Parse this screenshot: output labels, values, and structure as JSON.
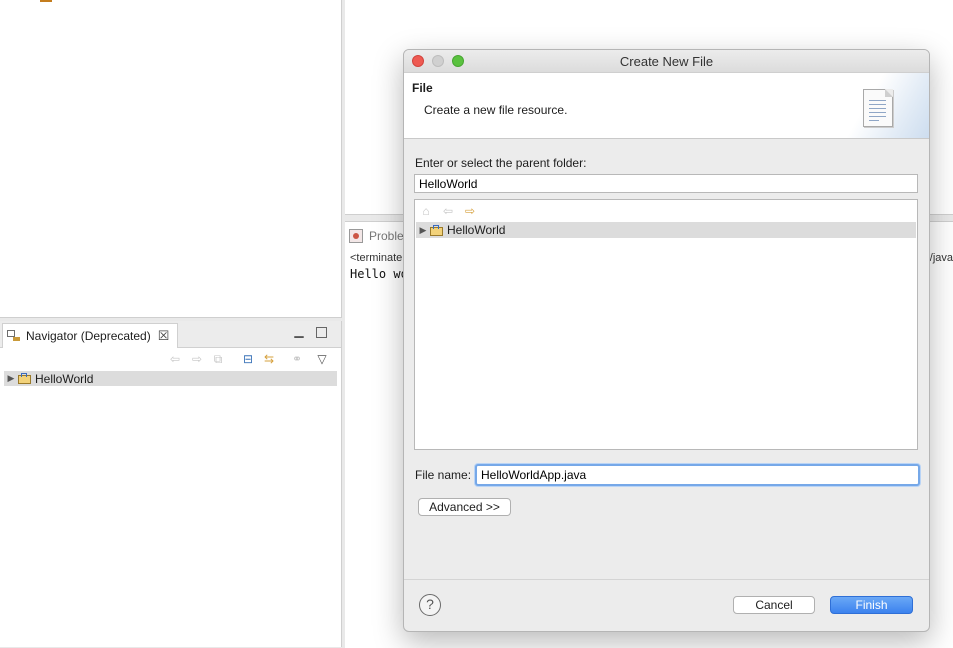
{
  "navigator": {
    "tab_title": "Navigator (Deprecated)",
    "tree_items": [
      {
        "label": "HelloWorld"
      }
    ]
  },
  "console": {
    "tab_title": "Proble",
    "terminated_text": "<terminate",
    "output_text": "Hello wo",
    "path_fragment": "n/java"
  },
  "dialog": {
    "title": "Create New File",
    "banner_title": "File",
    "banner_description": "Create a new file resource.",
    "parent_label": "Enter or select the parent folder:",
    "parent_value": "HelloWorld",
    "tree_items": [
      {
        "label": "HelloWorld"
      }
    ],
    "filename_label": "File name:",
    "filename_value": "HelloWorldApp.java",
    "advanced_label": "Advanced >>",
    "help_label": "?",
    "cancel_label": "Cancel",
    "finish_label": "Finish"
  },
  "colors": {
    "accent": "#3c82ee",
    "focus_ring": "#76a8e8",
    "close_traffic": "#ee5a52",
    "zoom_traffic": "#5ac23f"
  },
  "icons": [
    "tab-navigator-icon",
    "close-icon",
    "minimize-icon",
    "maximize-icon",
    "back-icon",
    "forward-icon",
    "up-icon",
    "collapse-all-icon",
    "link-editor-icon",
    "filter-icon",
    "view-menu-icon",
    "expand-arrow-icon",
    "project-folder-icon",
    "home-icon",
    "file-image-icon",
    "help-icon",
    "problems-icon"
  ]
}
